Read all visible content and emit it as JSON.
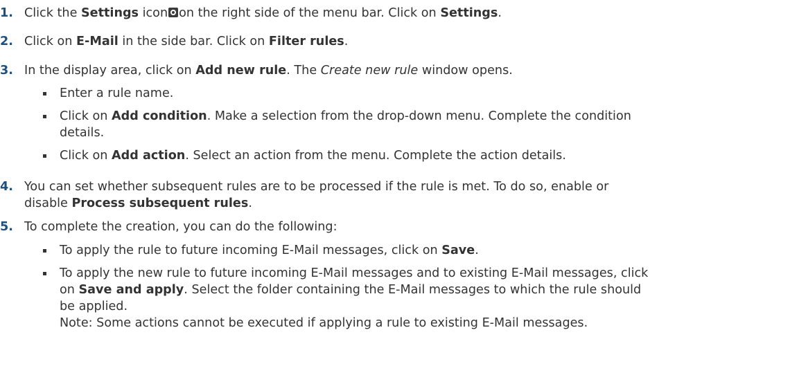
{
  "steps": [
    {
      "number": "1.",
      "parts": [
        "Click the ",
        "Settings",
        " icon",
        "on the right side of the menu bar. Click on ",
        "Settings",
        "."
      ]
    },
    {
      "number": "2.",
      "parts": [
        "Click on ",
        "E-Mail",
        " in the side bar. Click on ",
        "Filter rules",
        "."
      ]
    },
    {
      "number": "3.",
      "parts": [
        "In the display area, click on ",
        "Add new rule",
        ". The ",
        "Create new rule",
        " window opens."
      ],
      "bullets": [
        {
          "parts": [
            "Enter a rule name."
          ]
        },
        {
          "parts": [
            "Click on ",
            "Add condition",
            ". Make a selection from the drop-down menu. Complete the condition",
            "details."
          ]
        },
        {
          "parts": [
            "Click on ",
            "Add action",
            ". Select an action from the menu. Complete the action details."
          ]
        }
      ]
    },
    {
      "number": "4.",
      "parts": [
        "You can set whether subsequent rules are to be processed if the rule is met. To do so, enable or",
        "disable ",
        "Process subsequent rules",
        "."
      ]
    },
    {
      "number": "5.",
      "parts": [
        "To complete the creation, you can do the following:"
      ],
      "bullets": [
        {
          "parts": [
            "To apply the rule to future incoming E-Mail messages, click on ",
            "Save",
            "."
          ]
        },
        {
          "parts": [
            "To apply the new rule to future incoming E-Mail messages and to existing E-Mail messages, click",
            "on ",
            "Save and apply",
            ". Select the folder containing the E-Mail messages to which the rule should",
            "be applied.",
            "Note: Some actions cannot be executed if applying a rule to existing E-Mail messages."
          ]
        }
      ]
    }
  ],
  "icons": {
    "settings": "gear-icon"
  },
  "colors": {
    "step_number": "#1d4f80",
    "text": "#333333"
  }
}
